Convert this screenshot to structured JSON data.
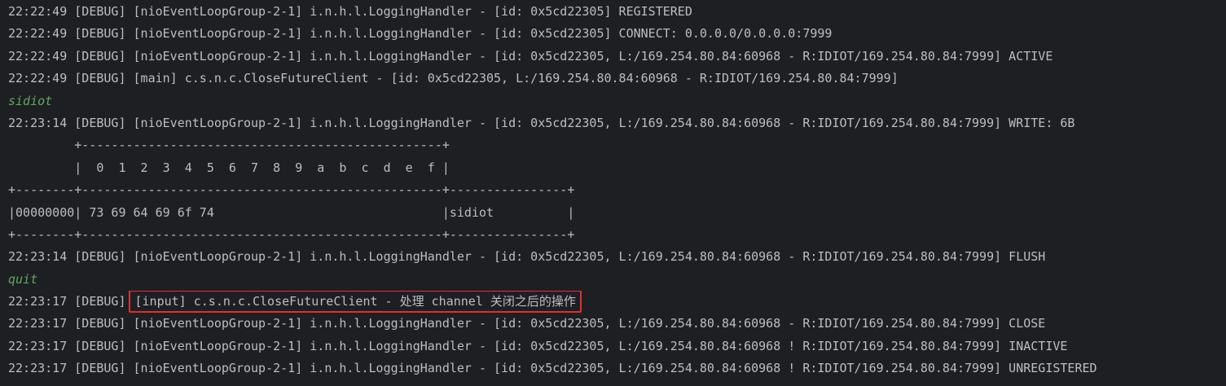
{
  "console": {
    "lines": [
      {
        "text": "22:22:49 [DEBUG] [nioEventLoopGroup-2-1] i.n.h.l.LoggingHandler - [id: 0x5cd22305] REGISTERED"
      },
      {
        "text": "22:22:49 [DEBUG] [nioEventLoopGroup-2-1] i.n.h.l.LoggingHandler - [id: 0x5cd22305] CONNECT: 0.0.0.0/0.0.0.0:7999"
      },
      {
        "text": "22:22:49 [DEBUG] [nioEventLoopGroup-2-1] i.n.h.l.LoggingHandler - [id: 0x5cd22305, L:/169.254.80.84:60968 - R:IDIOT/169.254.80.84:7999] ACTIVE"
      },
      {
        "text": "22:22:49 [DEBUG] [main] c.s.n.c.CloseFutureClient - [id: 0x5cd22305, L:/169.254.80.84:60968 - R:IDIOT/169.254.80.84:7999]"
      },
      {
        "text": "sidiot"
      },
      {
        "text": "22:23:14 [DEBUG] [nioEventLoopGroup-2-1] i.n.h.l.LoggingHandler - [id: 0x5cd22305, L:/169.254.80.84:60968 - R:IDIOT/169.254.80.84:7999] WRITE: 6B"
      },
      {
        "text": "         +-------------------------------------------------+"
      },
      {
        "text": "         |  0  1  2  3  4  5  6  7  8  9  a  b  c  d  e  f |"
      },
      {
        "text": "+--------+-------------------------------------------------+----------------+"
      },
      {
        "text": "|00000000| 73 69 64 69 6f 74                               |sidiot          |"
      },
      {
        "text": "+--------+-------------------------------------------------+----------------+"
      },
      {
        "text": "22:23:14 [DEBUG] [nioEventLoopGroup-2-1] i.n.h.l.LoggingHandler - [id: 0x5cd22305, L:/169.254.80.84:60968 - R:IDIOT/169.254.80.84:7999] FLUSH"
      },
      {
        "text": "quit"
      },
      {
        "prefix": "22:23:17 [DEBUG]",
        "highlight": "[input] c.s.n.c.CloseFutureClient - 处理 channel 关闭之后的操作"
      },
      {
        "text": "22:23:17 [DEBUG] [nioEventLoopGroup-2-1] i.n.h.l.LoggingHandler - [id: 0x5cd22305, L:/169.254.80.84:60968 - R:IDIOT/169.254.80.84:7999] CLOSE"
      },
      {
        "text": "22:23:17 [DEBUG] [nioEventLoopGroup-2-1] i.n.h.l.LoggingHandler - [id: 0x5cd22305, L:/169.254.80.84:60968 ! R:IDIOT/169.254.80.84:7999] INACTIVE"
      },
      {
        "text": "22:23:17 [DEBUG] [nioEventLoopGroup-2-1] i.n.h.l.LoggingHandler - [id: 0x5cd22305, L:/169.254.80.84:60968 ! R:IDIOT/169.254.80.84:7999] UNREGISTERED"
      }
    ]
  },
  "colors": {
    "background": "#1e1f22",
    "text": "#bcbec4",
    "user_input": "#5fa862",
    "highlight_box": "#e03131"
  }
}
